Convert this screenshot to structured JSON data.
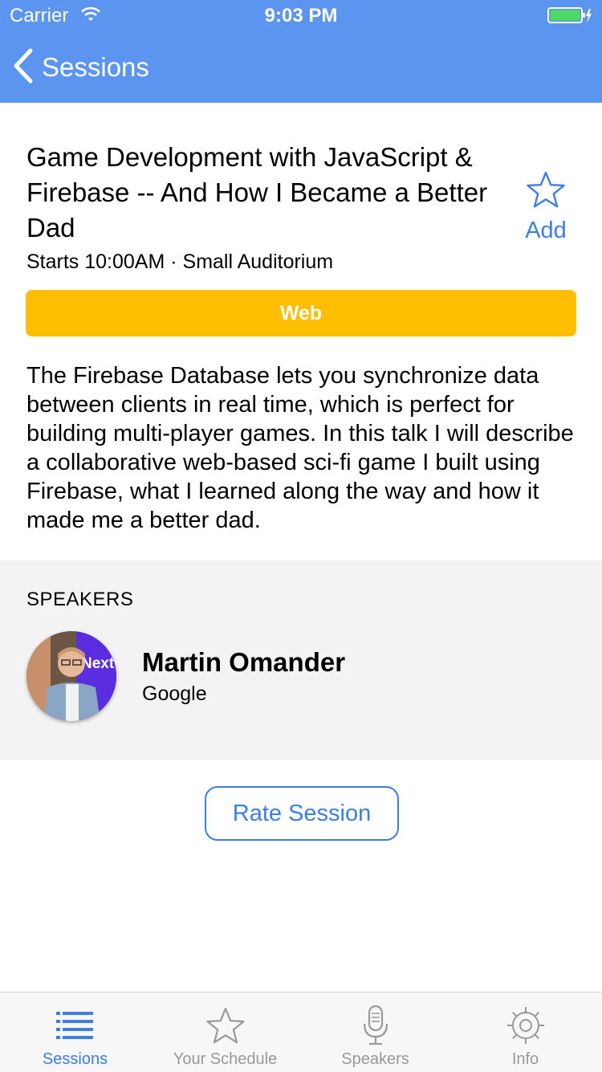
{
  "status_bar": {
    "carrier": "Carrier",
    "time": "9:03 PM"
  },
  "nav": {
    "back_label": "Sessions"
  },
  "session": {
    "title": "Game Development with JavaScript & Firebase -- And How I Became a Better Dad",
    "meta": "Starts 10:00AM · Small Auditorium",
    "add_label": "Add",
    "tag": "Web",
    "description": "The Firebase Database lets you synchronize data between clients in real time, which is perfect for building multi-player games. In this talk I will describe a collaborative web-based sci-fi game I built using Firebase, what I learned along the way and how it made me a better dad."
  },
  "speakers_section": {
    "title": "SPEAKERS",
    "speakers": [
      {
        "name": "Martin Omander",
        "company": "Google",
        "photo_text": "Next"
      }
    ]
  },
  "rate_label": "Rate Session",
  "tabs": [
    {
      "label": "Sessions",
      "icon": "list-icon",
      "active": true
    },
    {
      "label": "Your Schedule",
      "icon": "star-icon",
      "active": false
    },
    {
      "label": "Speakers",
      "icon": "microphone-icon",
      "active": false
    },
    {
      "label": "Info",
      "icon": "gear-icon",
      "active": false
    }
  ],
  "colors": {
    "nav": "#5b95f0",
    "accent": "#3d7ee0",
    "tag": "#fdbd00",
    "section_bg": "#f3f3f3"
  }
}
